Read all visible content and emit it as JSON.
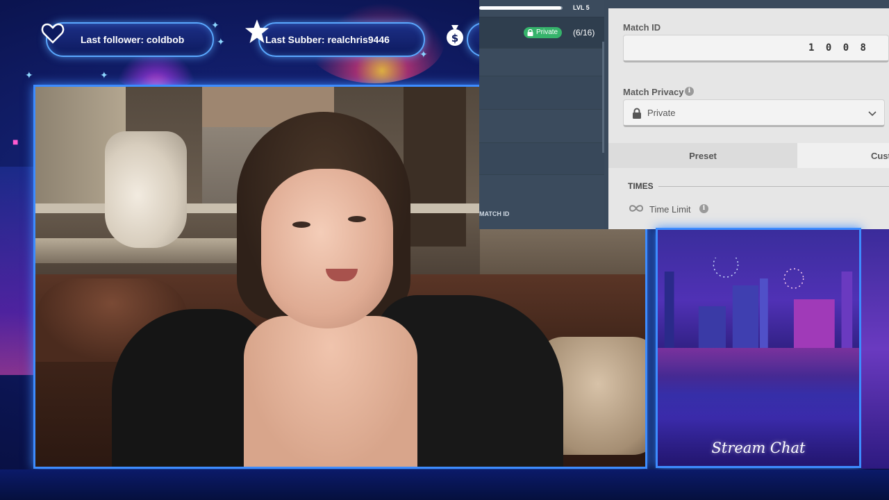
{
  "overlay": {
    "last_follower": "Last follower: coldbob",
    "last_subber": "Last Subber: realchris9446"
  },
  "game": {
    "level": "LVL 5",
    "xp_fraction": 0.98,
    "lobby_badge": "Private",
    "lobby_count": "(6/16)",
    "lobby_matchid_label": "MATCH ID",
    "match_id_label": "Match ID",
    "match_id_value": "1008",
    "match_privacy_label": "Match Privacy",
    "match_privacy_value": "Private",
    "tab_preset": "Preset",
    "tab_custom": "Cust",
    "times_header": "TIMES",
    "time_limit_label": "Time Limit",
    "accent_green": "#36b36b"
  },
  "chat": {
    "title": "Stream Chat"
  },
  "icons": {
    "follower": "heart-icon",
    "subber": "star-icon",
    "money": "money-bag-icon",
    "lock": "lock-icon",
    "info": "info-icon",
    "dropdown": "chevron-down-icon",
    "infinity": "infinity-icon"
  },
  "colors": {
    "frame_border": "#3d8cff",
    "overlay_bg": "#0b1450"
  }
}
